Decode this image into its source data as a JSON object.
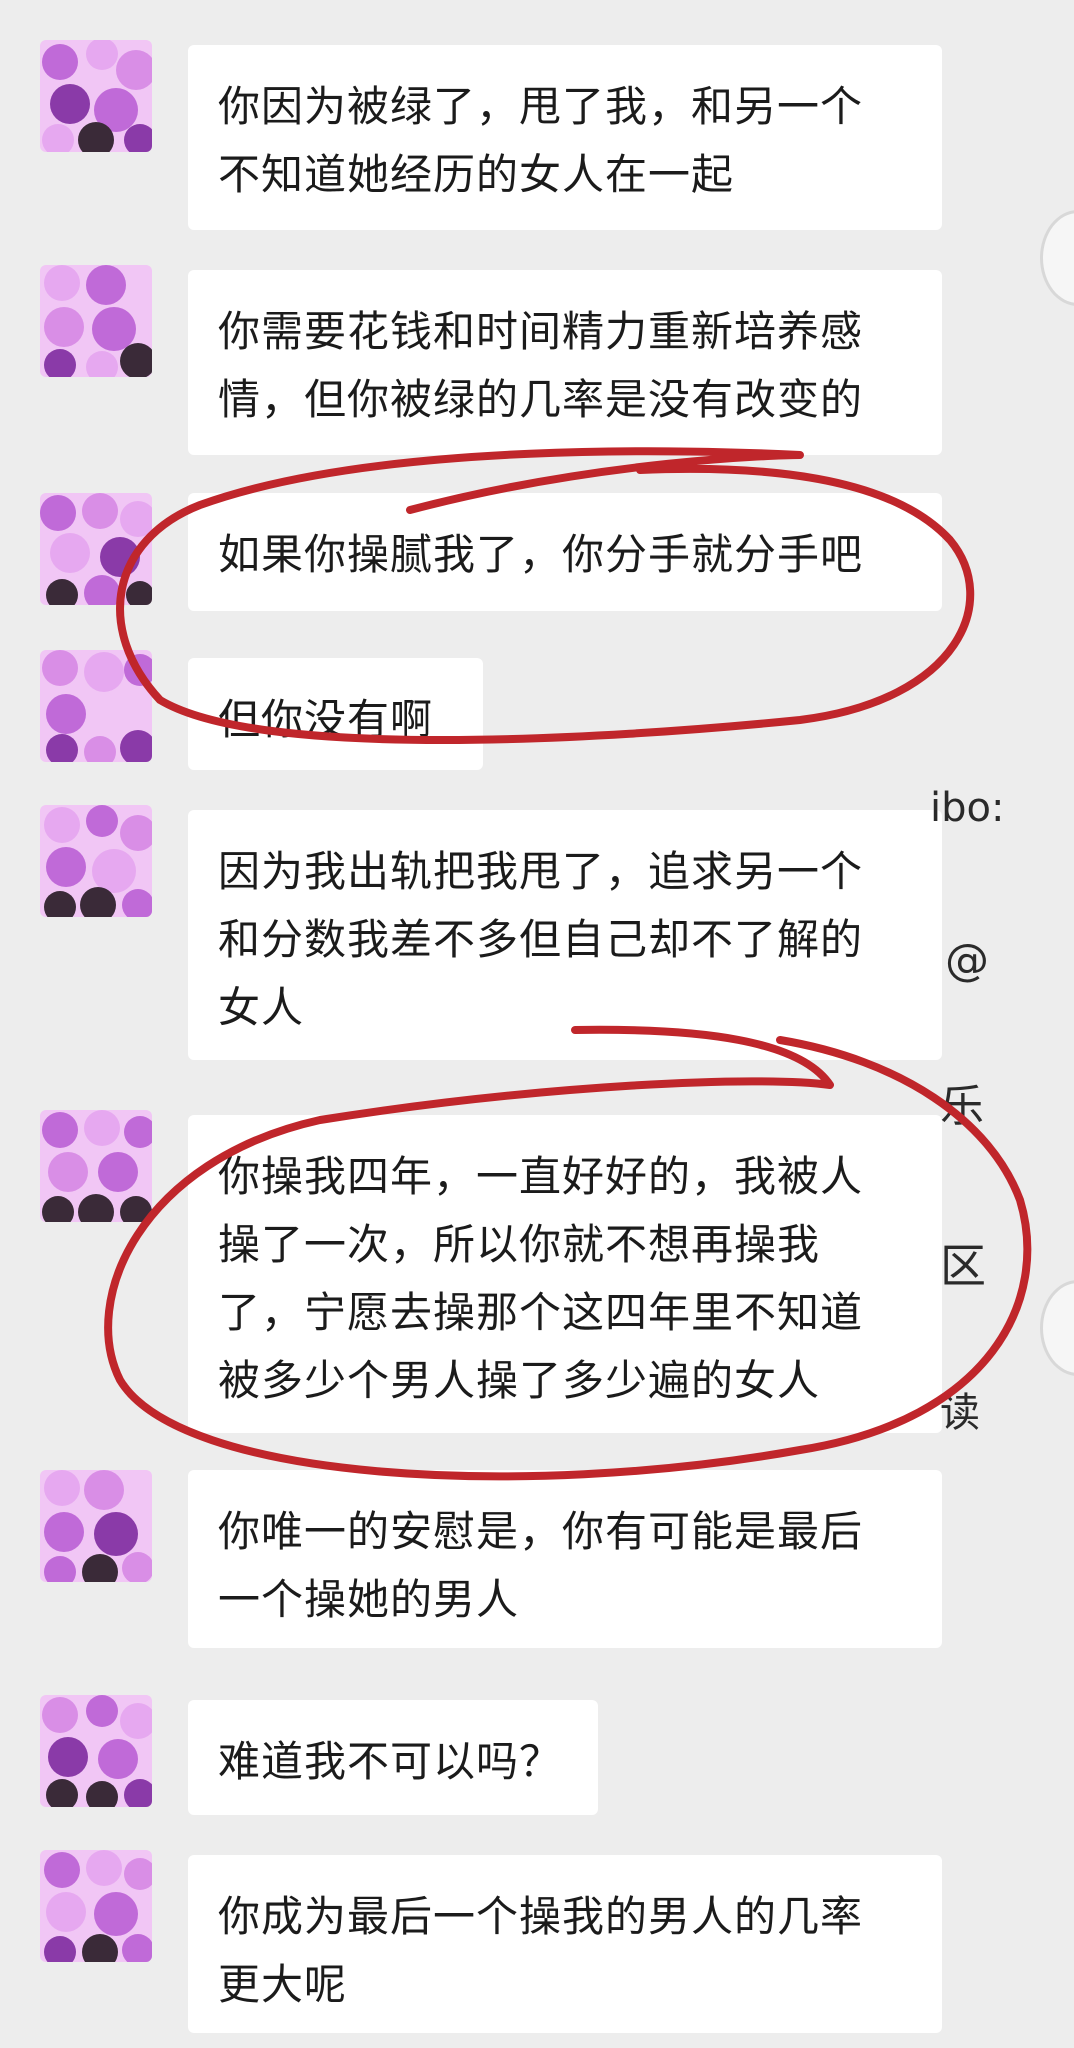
{
  "messages": [
    {
      "text": "你因为被绿了，甩了我，和另一个\n不知道她经历的女人在一起"
    },
    {
      "text": "你需要花钱和时间精力重新培养感\n情，但你被绿的几率是没有改变的"
    },
    {
      "text": "如果你操腻我了，你分手就分手吧"
    },
    {
      "text": "但你没有啊"
    },
    {
      "text": "因为我出轨把我甩了，追求另一个\n和分数我差不多但自己却不了解的\n女人"
    },
    {
      "text": "你操我四年，一直好好的，我被人\n操了一次，所以你就不想再操我\n了，宁愿去操那个这四年里不知道\n被多少个男人操了多少遍的女人"
    },
    {
      "text": "你唯一的安慰是，你有可能是最后\n一个操她的男人"
    },
    {
      "text": "难道我不可以吗？"
    },
    {
      "text": "你成为最后一个操我的男人的几率\n更大呢"
    }
  ],
  "background_fragments": {
    "frag1": "ibo:",
    "frag2": "@",
    "frag3": "乐",
    "frag4": "区",
    "frag5": "读"
  },
  "colors": {
    "background": "#ededed",
    "bubble": "#ffffff",
    "annotation": "#c0262b",
    "avatar_palette": [
      "#c06ad8",
      "#e6a8f0",
      "#8a3aa8",
      "#f1c6f5",
      "#3a2a38",
      "#d98ee6"
    ]
  },
  "icons": {
    "avatar": "mosaic-avatar-icon",
    "annotation": "red-hand-drawn-ellipse"
  }
}
